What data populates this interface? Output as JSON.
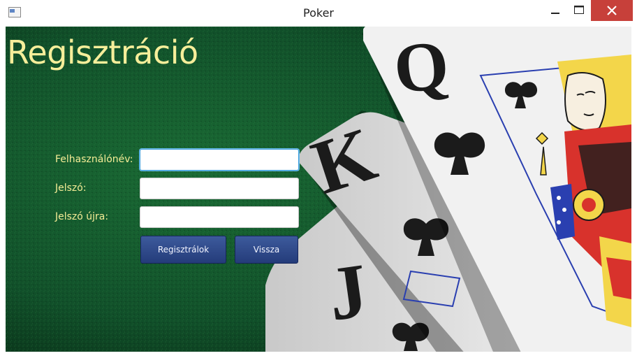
{
  "window": {
    "title": "Poker",
    "icons": [
      "app-icon",
      "minimize-icon",
      "maximize-icon",
      "close-icon"
    ],
    "close_color": "#c7403a"
  },
  "screen": {
    "heading": "Regisztráció",
    "heading_color": "#f6ee9a"
  },
  "form": {
    "username_label": "Felhasználónév:",
    "password_label": "Jelszó:",
    "password_again_label": "Jelszó újra:",
    "username_value": "",
    "password_value": "",
    "password_again_value": "",
    "register_button": "Regisztrálok",
    "back_button": "Vissza",
    "button_color": "#2c4585"
  },
  "cards": {
    "jack_rank": "J",
    "king_rank": "K",
    "queen_rank": "Q"
  }
}
